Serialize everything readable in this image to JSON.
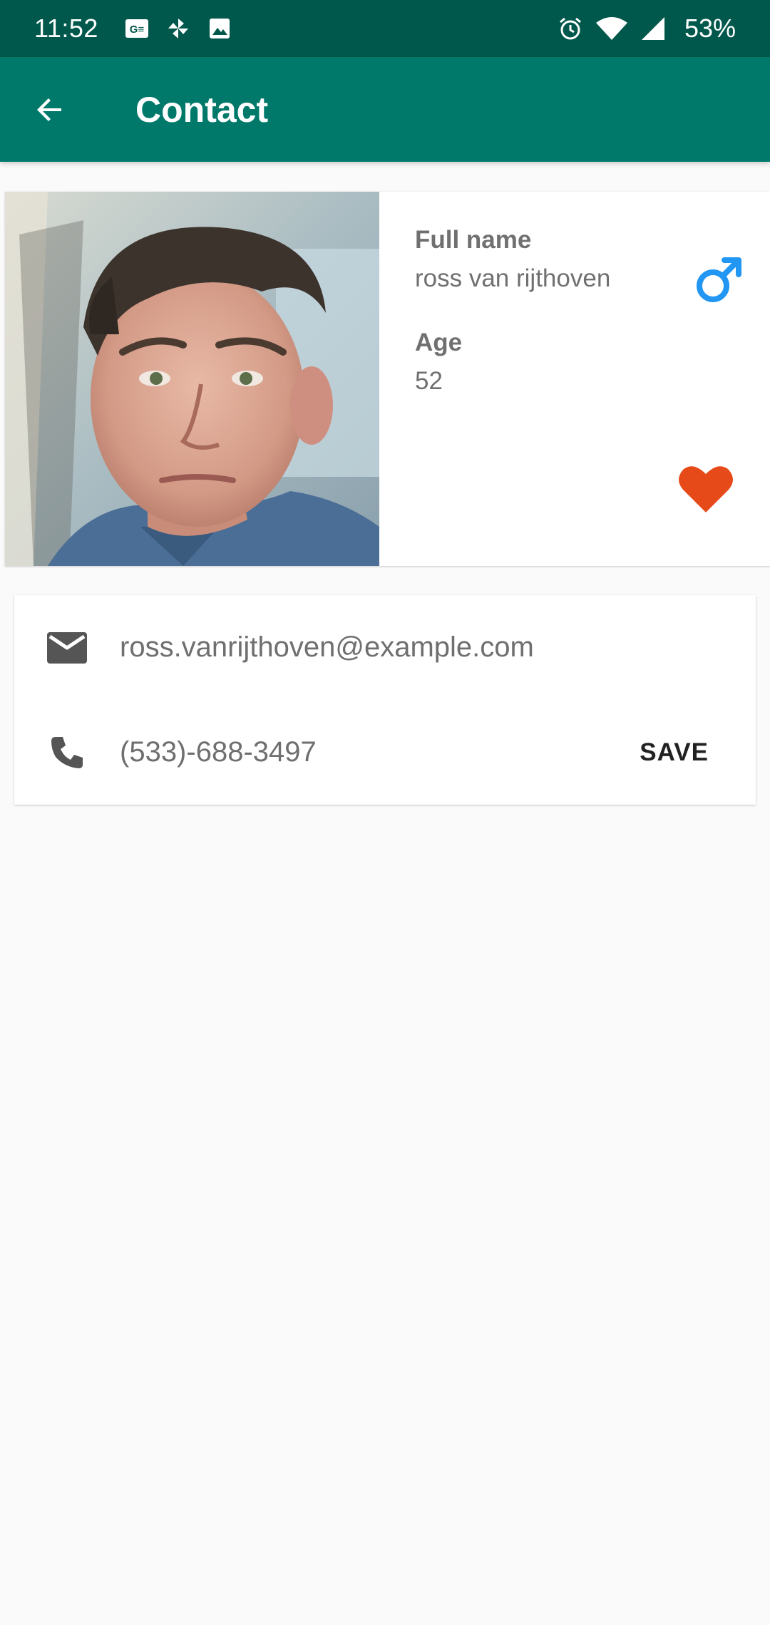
{
  "status_bar": {
    "time": "11:52",
    "battery": "53%",
    "left_icons": [
      "gmail-icon",
      "pinwheel-icon",
      "image-icon"
    ],
    "right_icons": [
      "alarm-icon",
      "wifi-icon",
      "signal-icon"
    ]
  },
  "app_bar": {
    "title": "Contact",
    "back_icon": "arrow-back-icon",
    "color": "#00796b",
    "status_color": "#00574b"
  },
  "profile": {
    "full_name_label": "Full name",
    "full_name": "ross van rijthoven",
    "age_label": "Age",
    "age": "52",
    "gender_icon": "male-icon",
    "gender_color": "#2196f3",
    "favorite_icon": "heart-icon",
    "favorite_color": "#e64a19"
  },
  "contact": {
    "email": "ross.vanrijthoven@example.com",
    "phone": "(533)-688-3497",
    "save_label": "SAVE",
    "email_icon": "email-icon",
    "phone_icon": "phone-icon"
  }
}
